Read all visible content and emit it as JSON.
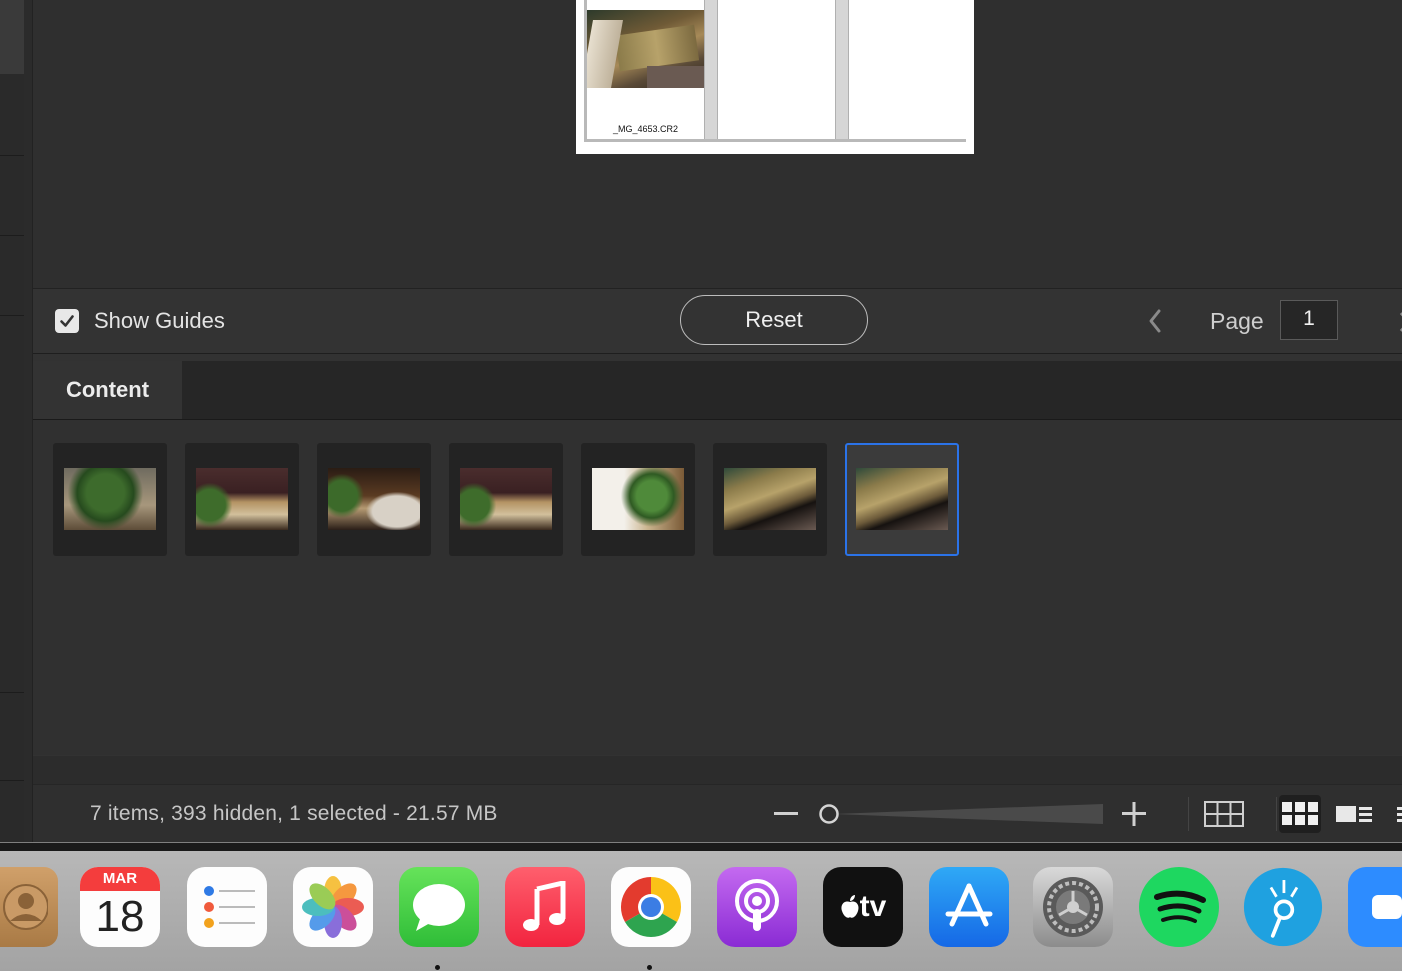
{
  "preview": {
    "caption": "_MG_4653.CR2"
  },
  "controls": {
    "show_guides_label": "Show Guides",
    "show_guides_checked": true,
    "reset_label": "Reset",
    "page_label": "Page",
    "page_value": "1"
  },
  "content": {
    "tab_label": "Content",
    "thumbnails": [
      {
        "style": "plant",
        "selected": false
      },
      {
        "style": "mixed",
        "selected": false
      },
      {
        "style": "vase",
        "selected": false
      },
      {
        "style": "mixed",
        "selected": false
      },
      {
        "style": "white",
        "selected": false
      },
      {
        "style": "wood",
        "selected": false
      },
      {
        "style": "wood",
        "selected": true
      }
    ]
  },
  "status": {
    "summary": "7 items, 393 hidden, 1 selected - 21.57 MB"
  },
  "dock": {
    "calendar_month": "MAR",
    "calendar_day": "18",
    "tv_label": "tv",
    "apps": [
      "contacts",
      "calendar",
      "reminders",
      "photos",
      "messages",
      "music",
      "chrome",
      "podcasts",
      "apple-tv",
      "app-store",
      "system-preferences",
      "spotify",
      "presentation-app",
      "zoom"
    ]
  },
  "colors": {
    "accent_selection": "#2b73e8",
    "panel_bg": "#303030",
    "dock_bg": "#b0b0b0"
  }
}
